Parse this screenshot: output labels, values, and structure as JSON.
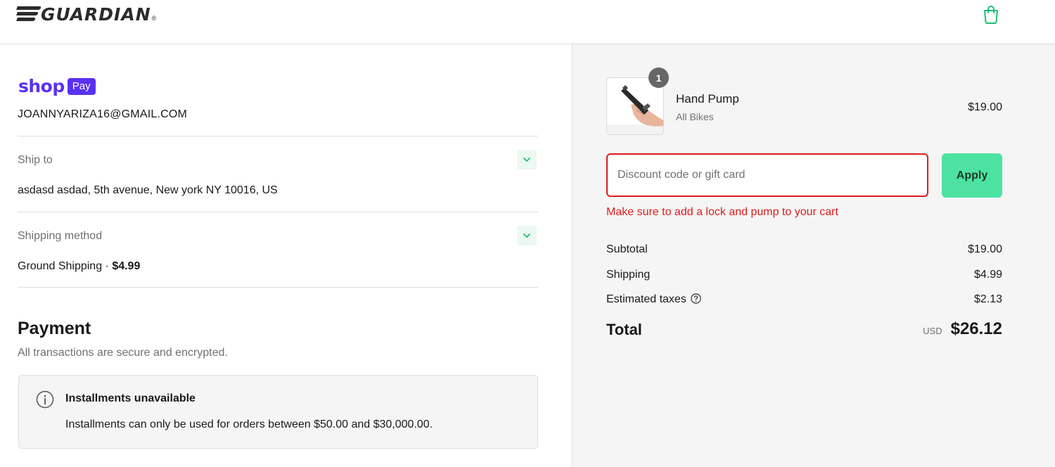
{
  "header": {
    "brand": "GUARDIAN",
    "brand_mark": "®",
    "cart_icon": "shopping-bag-icon",
    "accent_color": "#1dbf73"
  },
  "contact": {
    "shoppay_word": "shop",
    "shoppay_badge": "Pay",
    "shoppay_color": "#5a31f4",
    "email": "JOANNYARIZA16@GMAIL.COM"
  },
  "ship_to": {
    "label": "Ship to",
    "value": "asdasd asdad, 5th avenue, New york NY 10016, US",
    "toggle_icon": "chevron-down-icon"
  },
  "shipping_method": {
    "label": "Shipping method",
    "value": "Ground Shipping · ",
    "price": "$4.99",
    "toggle_icon": "chevron-down-icon"
  },
  "payment": {
    "title": "Payment",
    "subtitle": "All transactions are secure and encrypted.",
    "notice_icon": "info-icon",
    "notice_title": "Installments unavailable",
    "notice_text": "Installments can only be used for orders between $50.00 and $30,000.00."
  },
  "cart": {
    "item": {
      "quantity": "1",
      "name": "Hand Pump",
      "variant": "All Bikes",
      "price": "$19.00"
    },
    "discount": {
      "placeholder": "Discount code or gift card",
      "value": "",
      "apply_label": "Apply",
      "error": "Make sure to add a lock and pump to your cart",
      "error_color": "#dd1d1d",
      "button_color": "#4de2a1"
    },
    "summary": {
      "subtotal_label": "Subtotal",
      "subtotal": "$19.00",
      "shipping_label": "Shipping",
      "shipping": "$4.99",
      "taxes_label": "Estimated taxes",
      "taxes": "$2.13",
      "taxes_help_icon": "question-circle-icon",
      "total_label": "Total",
      "currency": "USD",
      "total": "$26.12"
    }
  }
}
